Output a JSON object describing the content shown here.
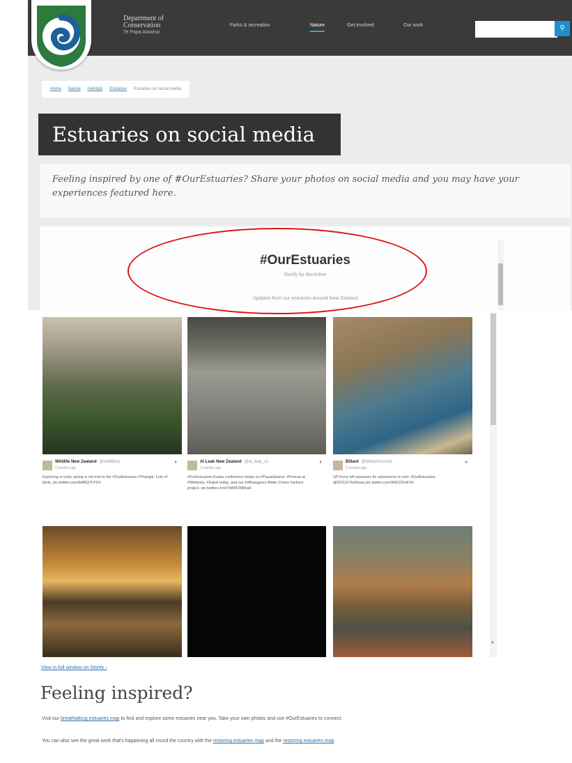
{
  "header": {
    "org_line1": "Department of",
    "org_line2": "Conservation",
    "org_line3": "Te Papa Atawhai",
    "nav": [
      "Parks & recreation",
      "Nature",
      "Get involved",
      "Our work"
    ],
    "active_nav": "Nature",
    "search_placeholder": "",
    "search_icon": "search-icon",
    "brand_color": "#3a3a3a",
    "accent_color": "#1f8fd0"
  },
  "breadcrumb": [
    "Home",
    "Nature",
    "Habitats",
    "Estuaries",
    "Estuaries on social media"
  ],
  "page": {
    "title": "Estuaries on social media",
    "intro": "Feeling inspired by one of #OurEstuaries? Share your photos on social media and you may have your experiences featured here."
  },
  "embed": {
    "hashtag": "#OurEstuaries",
    "byline": "Storify by doconline",
    "updates": "Updates from our estuaries around New Zealand",
    "tweets": [
      {
        "name": "Wildlife New Zealand",
        "handle": "@wildlifenz",
        "time": "2 months ago",
        "text": "Exploring a rocky spring is not lost to the #OurEstuaries #Triangle. Lots of birds. pic.twitter.com/9dBtQ7hTDV"
      },
      {
        "name": "Al Leak New Zealand",
        "handle": "@al_leak_nz",
        "time": "2 months ago",
        "text": "#OurEstuaries Kuaka conference today on #Pauatahanui. #Porirua at #Whitireia. #Kapiti today, and our #Whanganui Water Crews harbour project. pic.twitter.com/7dWRVNB5a9"
      },
      {
        "name": "Billard",
        "handle": "@billardnzsocial",
        "time": "2 months ago",
        "text": "UP Kerry left estuaries for adventures to sort. #OurEstuaries @DOCInTheNews pic.twitter.com/9bDZOmFIrK"
      }
    ]
  },
  "lower": {
    "view_link": "View in full window on Storify ›",
    "heading": "Feeling inspired?",
    "p1_before": "Visit our ",
    "p1_link": "breathtaking estuaries map",
    "p1_after": " to find and explore some estuaries near you. Take your own photos and use #OurEstuaries to connect.",
    "p2_before": "You can also see the great work that's happening all round the country with the ",
    "p2_link1": "restoring estuaries map",
    "p2_mid": " and the ",
    "p2_link2": "restoring estuaries map",
    "p2_end": "."
  }
}
